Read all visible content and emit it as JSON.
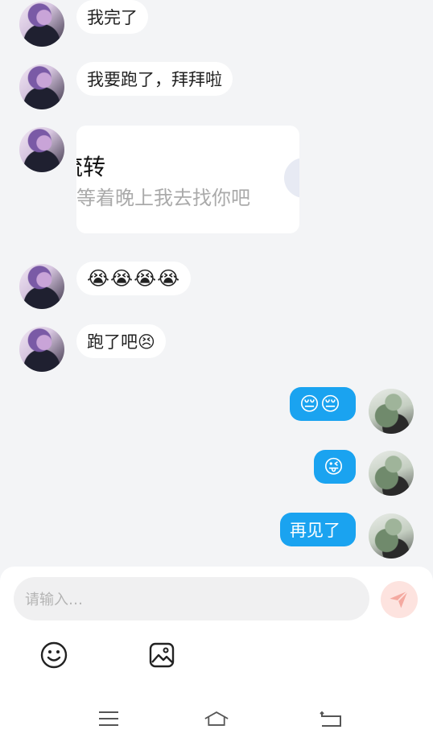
{
  "messages": [
    {
      "side": "left",
      "text": "我完了"
    },
    {
      "side": "left",
      "text": "我要跑了，拜拜啦"
    },
    {
      "side": "left",
      "card": {
        "title": "流转",
        "subtitle": "等着晚上我去找你吧"
      }
    },
    {
      "side": "left",
      "text": "😭😭😭😭"
    },
    {
      "side": "left",
      "text": "跑了吧😣"
    },
    {
      "side": "right",
      "text": "😔😔"
    },
    {
      "side": "right",
      "text": "😜"
    },
    {
      "side": "right",
      "text": "再见了"
    }
  ],
  "composer": {
    "placeholder": "请输入…",
    "send_icon": "paper-plane-icon",
    "tools": [
      "smiley-icon",
      "image-icon"
    ]
  },
  "navbar": {
    "icons": [
      "menu-icon",
      "home-icon",
      "back-icon"
    ]
  },
  "colors": {
    "background": "#f3f4f6",
    "bubble_left": "#ffffff",
    "bubble_right": "#1aa3f0",
    "send_button": "#fde3df",
    "send_icon": "#f4a9a0"
  }
}
